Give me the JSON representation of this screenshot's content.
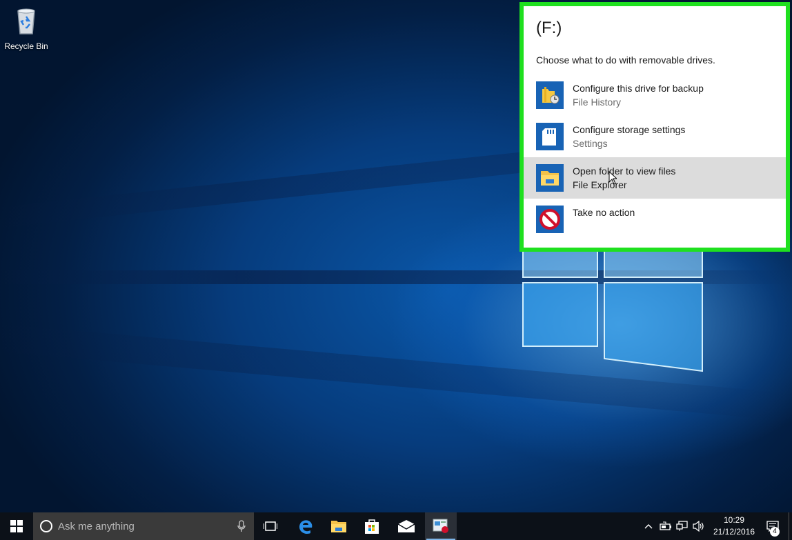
{
  "desktop": {
    "icons": [
      {
        "label": "Recycle Bin",
        "icon": "recycle-bin-icon"
      }
    ]
  },
  "autoplay": {
    "title": "(F:)",
    "subtitle": "Choose what to do with removable drives.",
    "highlight_color": "#1fe01f",
    "options": [
      {
        "primary": "Configure this drive for backup",
        "secondary": "File History",
        "icon": "file-history-icon"
      },
      {
        "primary": "Configure storage settings",
        "secondary": "Settings",
        "icon": "sd-card-icon"
      },
      {
        "primary": "Open folder to view files",
        "secondary": "File Explorer",
        "icon": "folder-icon",
        "hovered": true
      },
      {
        "primary": "Take no action",
        "secondary": "",
        "icon": "no-action-icon"
      }
    ]
  },
  "taskbar": {
    "search_placeholder": "Ask me anything",
    "pinned": [
      "task-view-icon",
      "edge-icon",
      "file-explorer-icon",
      "store-icon",
      "mail-icon",
      "autoplay-app-icon"
    ],
    "tray": {
      "time": "10:29",
      "date": "21/12/2016",
      "notification_count": "4"
    }
  }
}
